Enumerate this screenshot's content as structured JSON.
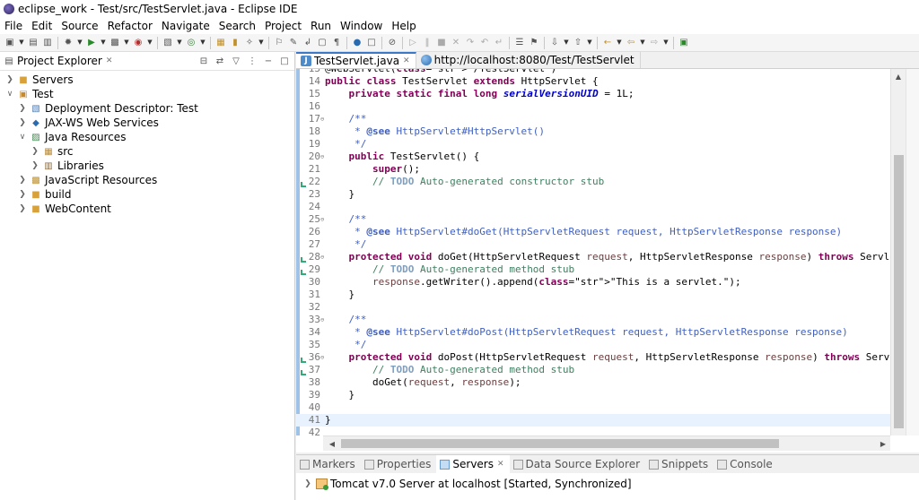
{
  "window": {
    "title": "eclipse_work - Test/src/TestServlet.java - Eclipse IDE"
  },
  "menu": [
    "File",
    "Edit",
    "Source",
    "Refactor",
    "Navigate",
    "Search",
    "Project",
    "Run",
    "Window",
    "Help"
  ],
  "explorer": {
    "title": "Project Explorer",
    "tree": [
      {
        "label": "Servers",
        "depth": 0,
        "expanded": false,
        "icon": "folder-icon"
      },
      {
        "label": "Test",
        "depth": 0,
        "expanded": true,
        "icon": "project-icon"
      },
      {
        "label": "Deployment Descriptor: Test",
        "depth": 1,
        "expanded": false,
        "icon": "descriptor-icon"
      },
      {
        "label": "JAX-WS Web Services",
        "depth": 1,
        "expanded": false,
        "icon": "webservice-icon"
      },
      {
        "label": "Java Resources",
        "depth": 1,
        "expanded": true,
        "icon": "java-resources-icon"
      },
      {
        "label": "src",
        "depth": 2,
        "expanded": false,
        "icon": "package-folder-icon"
      },
      {
        "label": "Libraries",
        "depth": 2,
        "expanded": false,
        "icon": "library-icon"
      },
      {
        "label": "JavaScript Resources",
        "depth": 1,
        "expanded": false,
        "icon": "js-resources-icon"
      },
      {
        "label": "build",
        "depth": 1,
        "expanded": false,
        "icon": "folder-icon"
      },
      {
        "label": "WebContent",
        "depth": 1,
        "expanded": false,
        "icon": "folder-icon"
      }
    ]
  },
  "editor": {
    "tabs": [
      {
        "label": "TestServlet.java",
        "active": true,
        "icon": "java-file-icon"
      },
      {
        "label": "http://localhost:8080/Test/TestServlet",
        "active": false,
        "icon": "web-browser-icon"
      }
    ],
    "lines": [
      {
        "n": "13",
        "fold": "",
        "text": "@WebServlet(\"/TestServlet\")"
      },
      {
        "n": "14",
        "fold": "",
        "text": "public class TestServlet extends HttpServlet {"
      },
      {
        "n": "15",
        "fold": "",
        "text": "    private static final long serialVersionUID = 1L;"
      },
      {
        "n": "16",
        "fold": "",
        "text": ""
      },
      {
        "n": "17",
        "fold": "⊖",
        "text": "    /**"
      },
      {
        "n": "18",
        "fold": "",
        "text": "     * @see HttpServlet#HttpServlet()"
      },
      {
        "n": "19",
        "fold": "",
        "text": "     */"
      },
      {
        "n": "20",
        "fold": "⊖",
        "text": "    public TestServlet() {"
      },
      {
        "n": "21",
        "fold": "",
        "text": "        super();"
      },
      {
        "n": "22",
        "fold": "",
        "text": "        // TODO Auto-generated constructor stub"
      },
      {
        "n": "23",
        "fold": "",
        "text": "    }"
      },
      {
        "n": "24",
        "fold": "",
        "text": ""
      },
      {
        "n": "25",
        "fold": "⊖",
        "text": "    /**"
      },
      {
        "n": "26",
        "fold": "",
        "text": "     * @see HttpServlet#doGet(HttpServletRequest request, HttpServletResponse response)"
      },
      {
        "n": "27",
        "fold": "",
        "text": "     */"
      },
      {
        "n": "28",
        "fold": "⊖",
        "text": "    protected void doGet(HttpServletRequest request, HttpServletResponse response) throws ServletExce"
      },
      {
        "n": "29",
        "fold": "",
        "text": "        // TODO Auto-generated method stub"
      },
      {
        "n": "30",
        "fold": "",
        "text": "        response.getWriter().append(\"This is a servlet.\");"
      },
      {
        "n": "31",
        "fold": "",
        "text": "    }"
      },
      {
        "n": "32",
        "fold": "",
        "text": ""
      },
      {
        "n": "33",
        "fold": "⊖",
        "text": "    /**"
      },
      {
        "n": "34",
        "fold": "",
        "text": "     * @see HttpServlet#doPost(HttpServletRequest request, HttpServletResponse response)"
      },
      {
        "n": "35",
        "fold": "",
        "text": "     */"
      },
      {
        "n": "36",
        "fold": "⊖",
        "text": "    protected void doPost(HttpServletRequest request, HttpServletResponse response) throws ServletExce"
      },
      {
        "n": "37",
        "fold": "",
        "text": "        // TODO Auto-generated method stub"
      },
      {
        "n": "38",
        "fold": "",
        "text": "        doGet(request, response);"
      },
      {
        "n": "39",
        "fold": "",
        "text": "    }"
      },
      {
        "n": "40",
        "fold": "",
        "text": ""
      },
      {
        "n": "41",
        "fold": "",
        "text": "}"
      },
      {
        "n": "42",
        "fold": "",
        "text": ""
      }
    ]
  },
  "bottom": {
    "tabs": [
      {
        "label": "Markers",
        "active": false
      },
      {
        "label": "Properties",
        "active": false
      },
      {
        "label": "Servers",
        "active": true
      },
      {
        "label": "Data Source Explorer",
        "active": false
      },
      {
        "label": "Snippets",
        "active": false
      },
      {
        "label": "Console",
        "active": false
      }
    ],
    "server": "Tomcat v7.0 Server at localhost  [Started, Synchronized]"
  }
}
